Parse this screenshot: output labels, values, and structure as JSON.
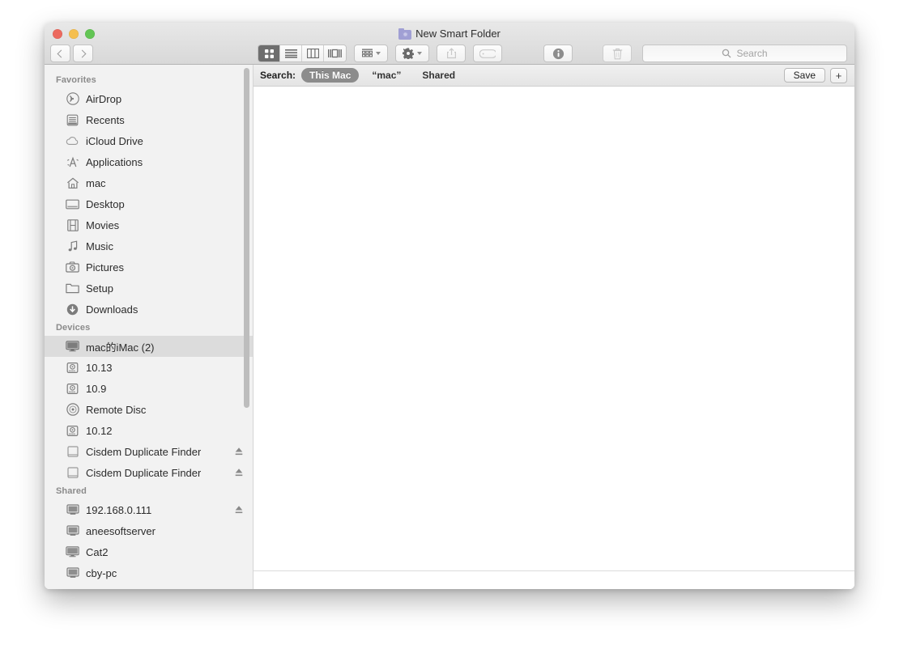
{
  "window": {
    "title": "New Smart Folder",
    "title_icon": "smart-folder-icon",
    "traffic_lights": {
      "close": "#ec6a5f",
      "minimize": "#f5bf4f",
      "zoom": "#62c554"
    }
  },
  "toolbar": {
    "back_label": "Back",
    "forward_label": "Forward",
    "view_modes": [
      {
        "name": "icon-view",
        "label": "Icon View",
        "active": true
      },
      {
        "name": "list-view",
        "label": "List View",
        "active": false
      },
      {
        "name": "column-view",
        "label": "Column View",
        "active": false
      },
      {
        "name": "gallery-view",
        "label": "Gallery View",
        "active": false
      }
    ],
    "arrange_label": "Arrange By",
    "action_label": "Action",
    "share_label": "Share",
    "tag_label": "Edit Tags",
    "info_label": "Get Info",
    "delete_label": "Delete"
  },
  "search": {
    "placeholder": "Search"
  },
  "searchbar": {
    "label": "Search:",
    "scopes": [
      {
        "label": "This Mac",
        "active": true
      },
      {
        "label": "“mac”",
        "active": false
      },
      {
        "label": "Shared",
        "active": false
      }
    ],
    "save_label": "Save",
    "add_label": "+"
  },
  "sidebar": {
    "sections": [
      {
        "header": "Favorites",
        "items": [
          {
            "label": "AirDrop",
            "icon": "airdrop-icon"
          },
          {
            "label": "Recents",
            "icon": "recents-icon"
          },
          {
            "label": "iCloud Drive",
            "icon": "icloud-icon"
          },
          {
            "label": "Applications",
            "icon": "applications-icon"
          },
          {
            "label": "mac",
            "icon": "home-icon"
          },
          {
            "label": "Desktop",
            "icon": "desktop-icon"
          },
          {
            "label": "Movies",
            "icon": "movies-icon"
          },
          {
            "label": "Music",
            "icon": "music-icon"
          },
          {
            "label": "Pictures",
            "icon": "pictures-icon"
          },
          {
            "label": "Setup",
            "icon": "folder-icon"
          },
          {
            "label": "Downloads",
            "icon": "downloads-icon"
          }
        ]
      },
      {
        "header": "Devices",
        "items": [
          {
            "label": "mac的iMac (2)",
            "icon": "imac-icon",
            "selected": true
          },
          {
            "label": "10.13",
            "icon": "harddisk-icon"
          },
          {
            "label": "10.9",
            "icon": "harddisk-icon"
          },
          {
            "label": "Remote Disc",
            "icon": "disc-icon"
          },
          {
            "label": "10.12",
            "icon": "harddisk-icon"
          },
          {
            "label": "Cisdem Duplicate Finder",
            "icon": "diskimage-icon",
            "eject": true
          },
          {
            "label": "Cisdem Duplicate Finder",
            "icon": "diskimage-icon",
            "eject": true
          }
        ]
      },
      {
        "header": "Shared",
        "items": [
          {
            "label": "192.168.0.111",
            "icon": "server-icon",
            "eject": true
          },
          {
            "label": "aneesoftserver",
            "icon": "server-icon"
          },
          {
            "label": "Cat2",
            "icon": "imac-icon"
          },
          {
            "label": "cby-pc",
            "icon": "server-icon",
            "clipped": true
          }
        ]
      }
    ]
  }
}
